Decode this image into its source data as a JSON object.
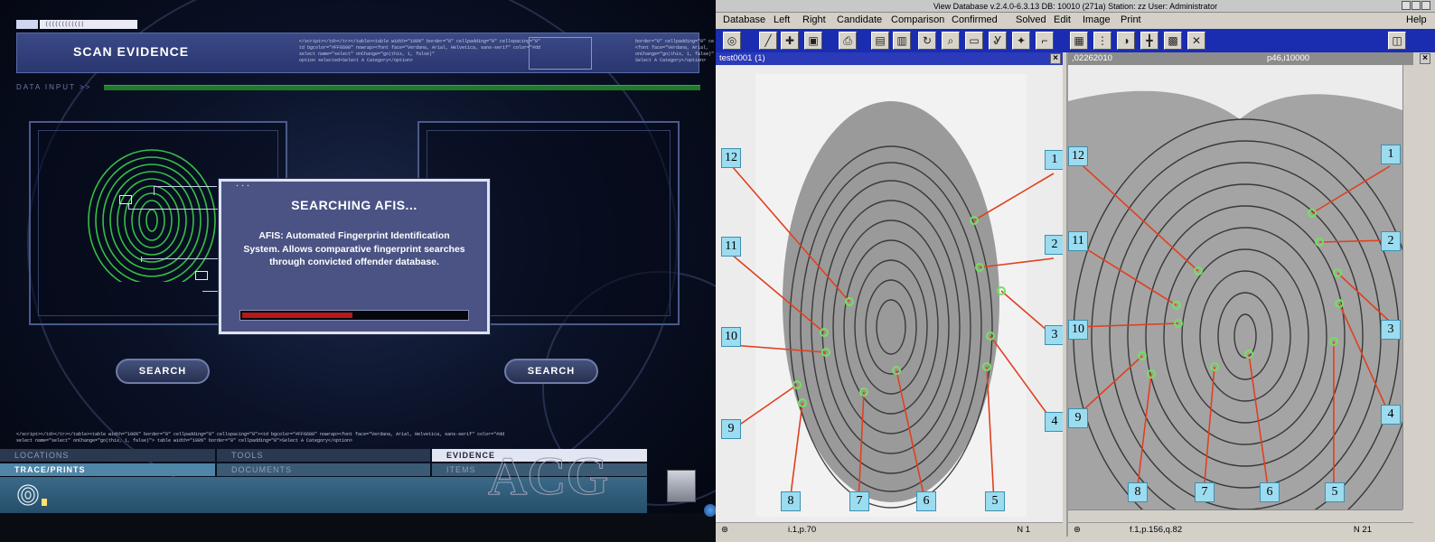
{
  "game": {
    "title": "SCAN EVIDENCE",
    "data_input_label": "DATA INPUT >>",
    "search_left": "SEARCH",
    "search_right": "SEARCH",
    "dialog": {
      "title": "SEARCHING AFIS...",
      "body": "AFIS: Automated Fingerprint Identification System. Allows comparative fingerprint searches through convicted offender database.",
      "progress": 0.5
    },
    "nav": {
      "locations": "LOCATIONS",
      "tools": "TOOLS",
      "evidence": "EVIDENCE",
      "trace_prints": "TRACE/PRINTS",
      "documents": "DOCUMENTS",
      "items": "ITEMS"
    },
    "watermark": "ACG",
    "colors": {
      "accent": "#4a5384",
      "progress": "#b81818",
      "print_green": "#3ad24a"
    }
  },
  "afis": {
    "window_title": "View Database v.2.4.0-6.3.13 DB:  10010 (271a) Station: zz User: Administrator",
    "menu": [
      "Database",
      "Left",
      "Right",
      "Candidate",
      "Comparison",
      "Confirmed",
      "Solved",
      "Edit",
      "Image",
      "Print",
      "Help"
    ],
    "left_pane": {
      "title": "test0001 (1)",
      "status_left": "i.1,p.70",
      "status_right": "N 1"
    },
    "right_pane": {
      "title": ",02262010",
      "title_right": "p46,i10000",
      "status_left": "f.1,p.156,q.82",
      "status_right": "N 21"
    },
    "markers": [
      "1",
      "2",
      "3",
      "4",
      "5",
      "6",
      "7",
      "8",
      "9",
      "10",
      "11",
      "12"
    ],
    "colors": {
      "toolbar": "#1a2cb0",
      "marker_fill": "#9cdcf0",
      "line": "#e04020",
      "minutia": "#74e060"
    }
  }
}
